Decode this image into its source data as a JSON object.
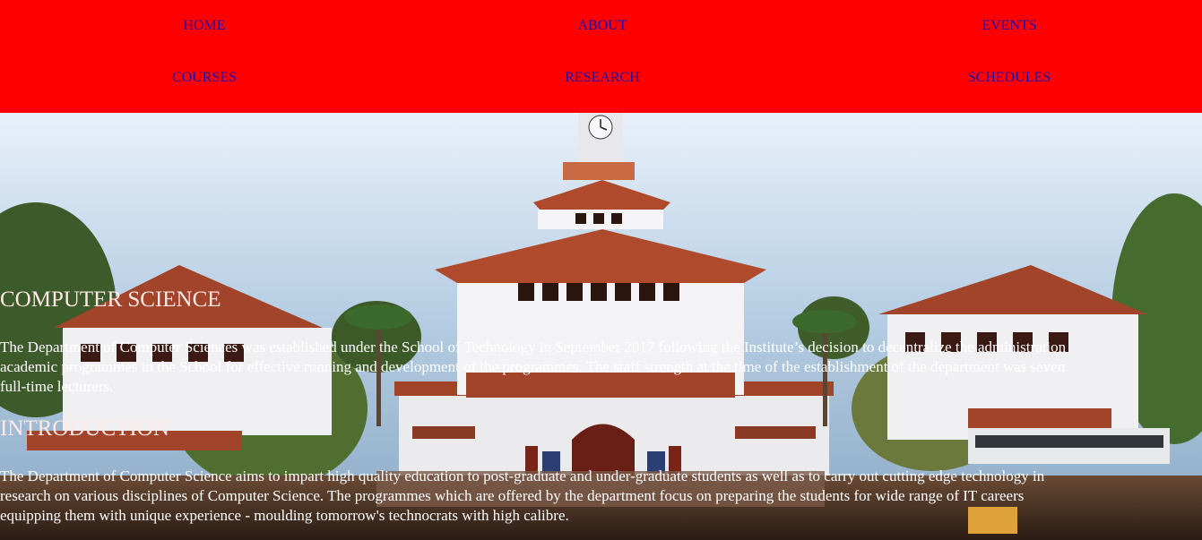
{
  "nav": {
    "row1": [
      "HOME",
      "ABOUT",
      "EVENTS"
    ],
    "row2": [
      "COURSES",
      "RESEARCH",
      "SCHEDULES"
    ]
  },
  "sections": {
    "computer_science": {
      "heading": "COMPUTER SCIENCE",
      "lines": [
        "The Department of Computer Sciences was established under the School of Technology in September 2017 following the Institute’s decision to decentralize the administration",
        "academic programmes in the School for effective running and development of the programmes. The staff strength at the time of the establishment of the department was seven",
        "full-time lecturers."
      ]
    },
    "introduction": {
      "heading": "INTRODUCTION",
      "lines": [
        "The Department of Computer Science aims to impart high quality education to post-graduate and under-graduate students as well as to carry out cutting edge technology in",
        "research on various disciplines of Computer Science. The programmes which are offered by the department focus on preparing the students for wide range of IT careers",
        "equipping them with unique experience - moulding tomorrow's technocrats with high calibre."
      ]
    }
  },
  "colors": {
    "nav_bg": "#ff0000",
    "nav_link": "#1a0dab",
    "heading": "#ffe9e6",
    "body_text": "#ffffff"
  }
}
